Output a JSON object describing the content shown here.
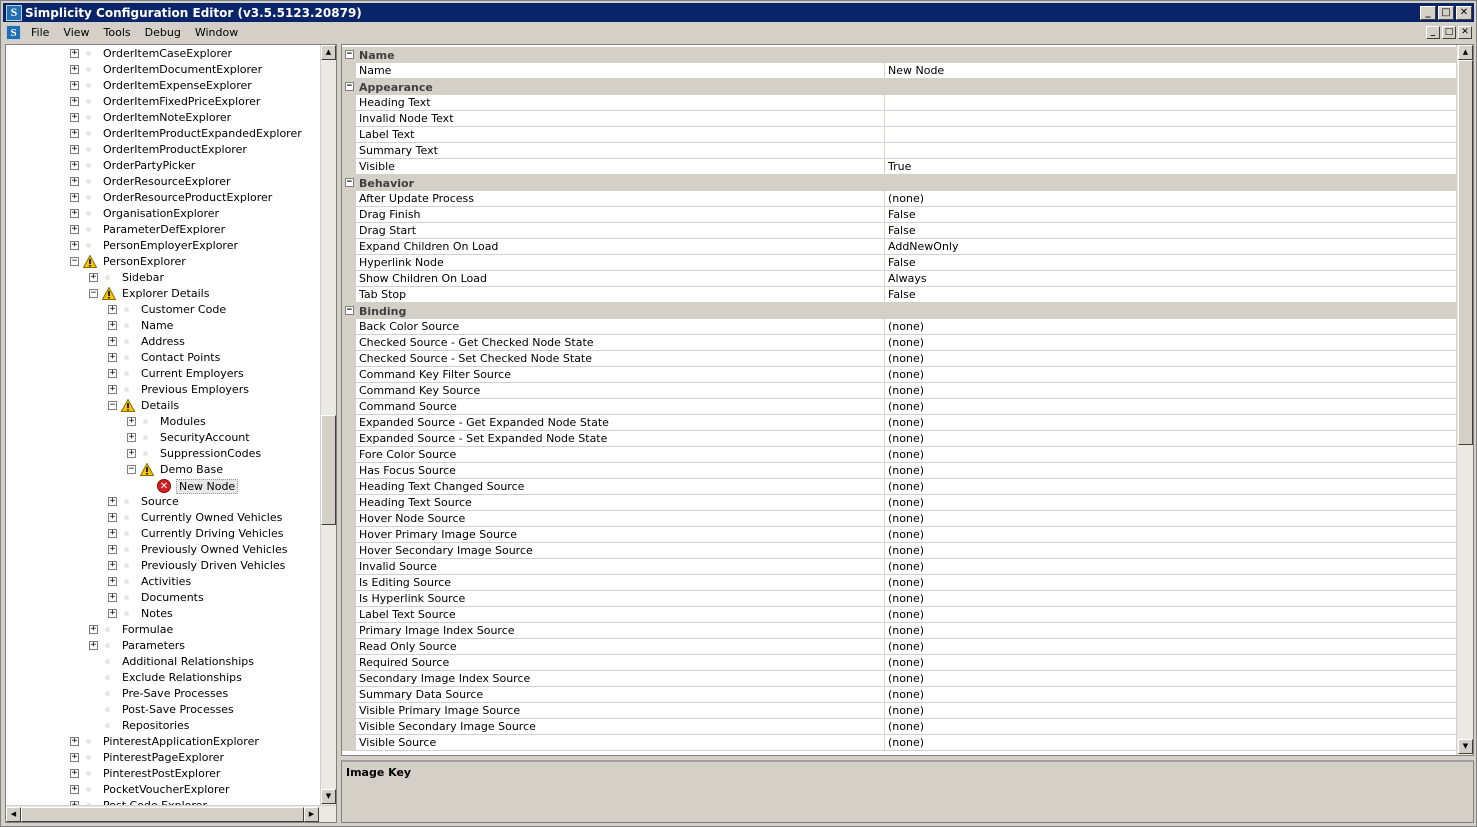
{
  "window": {
    "title": "Simplicity Configuration Editor (v3.5.5123.20879)",
    "app_icon_letter": "S",
    "controls": {
      "minimize": "_",
      "maximize": "□",
      "close": "✕",
      "restore": "🗗"
    }
  },
  "menu": {
    "items": [
      "File",
      "View",
      "Tools",
      "Debug",
      "Window"
    ]
  },
  "tree": {
    "selected": "New Node",
    "items": [
      {
        "label": "OrderItemCaseExplorer",
        "level": 0,
        "expander": "+",
        "icon": "dot"
      },
      {
        "label": "OrderItemDocumentExplorer",
        "level": 0,
        "expander": "+",
        "icon": "dot"
      },
      {
        "label": "OrderItemExpenseExplorer",
        "level": 0,
        "expander": "+",
        "icon": "dot"
      },
      {
        "label": "OrderItemFixedPriceExplorer",
        "level": 0,
        "expander": "+",
        "icon": "dot"
      },
      {
        "label": "OrderItemNoteExplorer",
        "level": 0,
        "expander": "+",
        "icon": "dot"
      },
      {
        "label": "OrderItemProductExpandedExplorer",
        "level": 0,
        "expander": "+",
        "icon": "dot"
      },
      {
        "label": "OrderItemProductExplorer",
        "level": 0,
        "expander": "+",
        "icon": "dot"
      },
      {
        "label": "OrderPartyPicker",
        "level": 0,
        "expander": "+",
        "icon": "dot"
      },
      {
        "label": "OrderResourceExplorer",
        "level": 0,
        "expander": "+",
        "icon": "dot"
      },
      {
        "label": "OrderResourceProductExplorer",
        "level": 0,
        "expander": "+",
        "icon": "dot"
      },
      {
        "label": "OrganisationExplorer",
        "level": 0,
        "expander": "+",
        "icon": "dot"
      },
      {
        "label": "ParameterDefExplorer",
        "level": 0,
        "expander": "+",
        "icon": "dot"
      },
      {
        "label": "PersonEmployerExplorer",
        "level": 0,
        "expander": "+",
        "icon": "dot"
      },
      {
        "label": "PersonExplorer",
        "level": 0,
        "expander": "−",
        "icon": "warning"
      },
      {
        "label": "Sidebar",
        "level": 1,
        "expander": "+",
        "icon": "dot"
      },
      {
        "label": "Explorer Details",
        "level": 1,
        "expander": "−",
        "icon": "warning"
      },
      {
        "label": "Customer Code",
        "level": 2,
        "expander": "+",
        "icon": "dot"
      },
      {
        "label": "Name",
        "level": 2,
        "expander": "+",
        "icon": "dot"
      },
      {
        "label": "Address",
        "level": 2,
        "expander": "+",
        "icon": "dot"
      },
      {
        "label": "Contact Points",
        "level": 2,
        "expander": "+",
        "icon": "dot"
      },
      {
        "label": "Current Employers",
        "level": 2,
        "expander": "+",
        "icon": "dot"
      },
      {
        "label": "Previous Employers",
        "level": 2,
        "expander": "+",
        "icon": "dot"
      },
      {
        "label": "Details",
        "level": 2,
        "expander": "−",
        "icon": "warning"
      },
      {
        "label": "Modules",
        "level": 3,
        "expander": "+",
        "icon": "dot"
      },
      {
        "label": "SecurityAccount",
        "level": 3,
        "expander": "+",
        "icon": "dot"
      },
      {
        "label": "SuppressionCodes",
        "level": 3,
        "expander": "+",
        "icon": "dot"
      },
      {
        "label": "Demo Base",
        "level": 3,
        "expander": "−",
        "icon": "warning"
      },
      {
        "label": "New Node",
        "level": 4,
        "expander": "",
        "icon": "error"
      },
      {
        "label": "Source",
        "level": 2,
        "expander": "+",
        "icon": "dot"
      },
      {
        "label": "Currently Owned Vehicles",
        "level": 2,
        "expander": "+",
        "icon": "dot"
      },
      {
        "label": "Currently Driving Vehicles",
        "level": 2,
        "expander": "+",
        "icon": "dot"
      },
      {
        "label": "Previously Owned Vehicles",
        "level": 2,
        "expander": "+",
        "icon": "dot"
      },
      {
        "label": "Previously Driven Vehicles",
        "level": 2,
        "expander": "+",
        "icon": "dot"
      },
      {
        "label": "Activities",
        "level": 2,
        "expander": "+",
        "icon": "dot"
      },
      {
        "label": "Documents",
        "level": 2,
        "expander": "+",
        "icon": "dot"
      },
      {
        "label": "Notes",
        "level": 2,
        "expander": "+",
        "icon": "dot"
      },
      {
        "label": "Formulae",
        "level": 1,
        "expander": "+",
        "icon": "dot"
      },
      {
        "label": "Parameters",
        "level": 1,
        "expander": "+",
        "icon": "dot"
      },
      {
        "label": "Additional Relationships",
        "level": 1,
        "expander": "",
        "icon": "dot"
      },
      {
        "label": "Exclude Relationships",
        "level": 1,
        "expander": "",
        "icon": "dot"
      },
      {
        "label": "Pre-Save Processes",
        "level": 1,
        "expander": "",
        "icon": "dot"
      },
      {
        "label": "Post-Save Processes",
        "level": 1,
        "expander": "",
        "icon": "dot"
      },
      {
        "label": "Repositories",
        "level": 1,
        "expander": "",
        "icon": "dot"
      },
      {
        "label": "PinterestApplicationExplorer",
        "level": 0,
        "expander": "+",
        "icon": "dot"
      },
      {
        "label": "PinterestPageExplorer",
        "level": 0,
        "expander": "+",
        "icon": "dot"
      },
      {
        "label": "PinterestPostExplorer",
        "level": 0,
        "expander": "+",
        "icon": "dot"
      },
      {
        "label": "PocketVoucherExplorer",
        "level": 0,
        "expander": "+",
        "icon": "dot"
      },
      {
        "label": "Post Code Explorer",
        "level": 0,
        "expander": "+",
        "icon": "dot"
      }
    ]
  },
  "property_grid": {
    "rows": [
      {
        "type": "category",
        "label": "Name"
      },
      {
        "type": "property",
        "name": "Name",
        "value": "New Node"
      },
      {
        "type": "category",
        "label": "Appearance"
      },
      {
        "type": "property",
        "name": "Heading Text",
        "value": ""
      },
      {
        "type": "property",
        "name": "Invalid Node Text",
        "value": ""
      },
      {
        "type": "property",
        "name": "Label Text",
        "value": ""
      },
      {
        "type": "property",
        "name": "Summary Text",
        "value": ""
      },
      {
        "type": "property",
        "name": "Visible",
        "value": "True"
      },
      {
        "type": "category",
        "label": "Behavior"
      },
      {
        "type": "property",
        "name": "After Update Process",
        "value": "(none)"
      },
      {
        "type": "property",
        "name": "Drag Finish",
        "value": "False"
      },
      {
        "type": "property",
        "name": "Drag Start",
        "value": "False"
      },
      {
        "type": "property",
        "name": "Expand Children On Load",
        "value": "AddNewOnly"
      },
      {
        "type": "property",
        "name": "Hyperlink Node",
        "value": "False"
      },
      {
        "type": "property",
        "name": "Show Children On Load",
        "value": "Always"
      },
      {
        "type": "property",
        "name": "Tab Stop",
        "value": "False"
      },
      {
        "type": "category",
        "label": "Binding"
      },
      {
        "type": "property",
        "name": "Back Color Source",
        "value": "(none)"
      },
      {
        "type": "property",
        "name": "Checked Source - Get Checked Node State",
        "value": "(none)"
      },
      {
        "type": "property",
        "name": "Checked Source - Set Checked Node State",
        "value": "(none)"
      },
      {
        "type": "property",
        "name": "Command Key Filter Source",
        "value": "(none)"
      },
      {
        "type": "property",
        "name": "Command Key Source",
        "value": "(none)"
      },
      {
        "type": "property",
        "name": "Command Source",
        "value": "(none)"
      },
      {
        "type": "property",
        "name": "Expanded Source - Get Expanded Node State",
        "value": "(none)"
      },
      {
        "type": "property",
        "name": "Expanded Source - Set Expanded Node State",
        "value": "(none)"
      },
      {
        "type": "property",
        "name": "Fore Color Source",
        "value": "(none)"
      },
      {
        "type": "property",
        "name": "Has Focus Source",
        "value": "(none)"
      },
      {
        "type": "property",
        "name": "Heading Text Changed Source",
        "value": "(none)"
      },
      {
        "type": "property",
        "name": "Heading Text Source",
        "value": "(none)"
      },
      {
        "type": "property",
        "name": "Hover Node Source",
        "value": "(none)"
      },
      {
        "type": "property",
        "name": "Hover Primary Image Source",
        "value": "(none)"
      },
      {
        "type": "property",
        "name": "Hover Secondary Image Source",
        "value": "(none)"
      },
      {
        "type": "property",
        "name": "Invalid Source",
        "value": "(none)"
      },
      {
        "type": "property",
        "name": "Is Editing Source",
        "value": "(none)"
      },
      {
        "type": "property",
        "name": "Is Hyperlink Source",
        "value": "(none)"
      },
      {
        "type": "property",
        "name": "Label Text Source",
        "value": "(none)"
      },
      {
        "type": "property",
        "name": "Primary Image Index Source",
        "value": "(none)"
      },
      {
        "type": "property",
        "name": "Read Only Source",
        "value": "(none)"
      },
      {
        "type": "property",
        "name": "Required Source",
        "value": "(none)"
      },
      {
        "type": "property",
        "name": "Secondary Image Index Source",
        "value": "(none)"
      },
      {
        "type": "property",
        "name": "Summary Data Source",
        "value": "(none)"
      },
      {
        "type": "property",
        "name": "Visible Primary Image Source",
        "value": "(none)"
      },
      {
        "type": "property",
        "name": "Visible Secondary Image Source",
        "value": "(none)"
      },
      {
        "type": "property",
        "name": "Visible Source",
        "value": "(none)"
      }
    ]
  },
  "description": {
    "title": "Image Key"
  },
  "colors": {
    "titlebar": "#0a246a",
    "chrome": "#d4d0c8",
    "warning": "#f5c400",
    "error": "#d21f1f"
  }
}
